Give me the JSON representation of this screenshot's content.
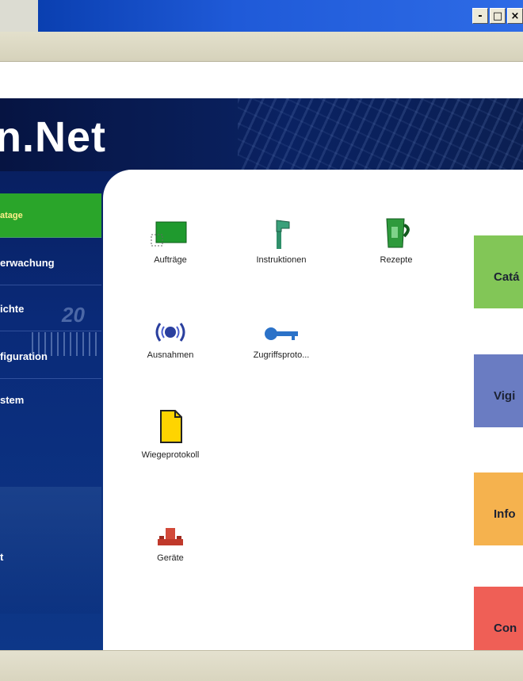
{
  "window": {
    "minimize_glyph": "-",
    "maximize_glyph": "□",
    "close_glyph": "×"
  },
  "app": {
    "title": "n.Net"
  },
  "nav": {
    "items": [
      {
        "label": "atage",
        "active": true
      },
      {
        "label": "erwachung",
        "active": false
      },
      {
        "label": "ichte",
        "active": false
      },
      {
        "label": "figuration",
        "active": false
      },
      {
        "label": "stem",
        "active": false
      },
      {
        "label": "t",
        "active": false
      }
    ],
    "deco_number": "20"
  },
  "icons": [
    {
      "label": "Aufträge",
      "icon": "orders-icon"
    },
    {
      "label": "Instruktionen",
      "icon": "instructions-icon"
    },
    {
      "label": "Rezepte",
      "icon": "recipes-icon"
    },
    {
      "label": "Ausnahmen",
      "icon": "exceptions-icon"
    },
    {
      "label": "Zugriffsproto...",
      "icon": "access-log-icon"
    },
    {
      "label": "Wiegeprotokoll",
      "icon": "weighing-log-icon"
    },
    {
      "label": "Geräte",
      "icon": "devices-icon"
    }
  ],
  "categories": [
    {
      "label": "Catá",
      "color": "#82c657"
    },
    {
      "label": "Vigi",
      "color": "#6a7cc2"
    },
    {
      "label": "Info",
      "color": "#f5b24e"
    },
    {
      "label": "Con",
      "color": "#ef5f56"
    }
  ]
}
